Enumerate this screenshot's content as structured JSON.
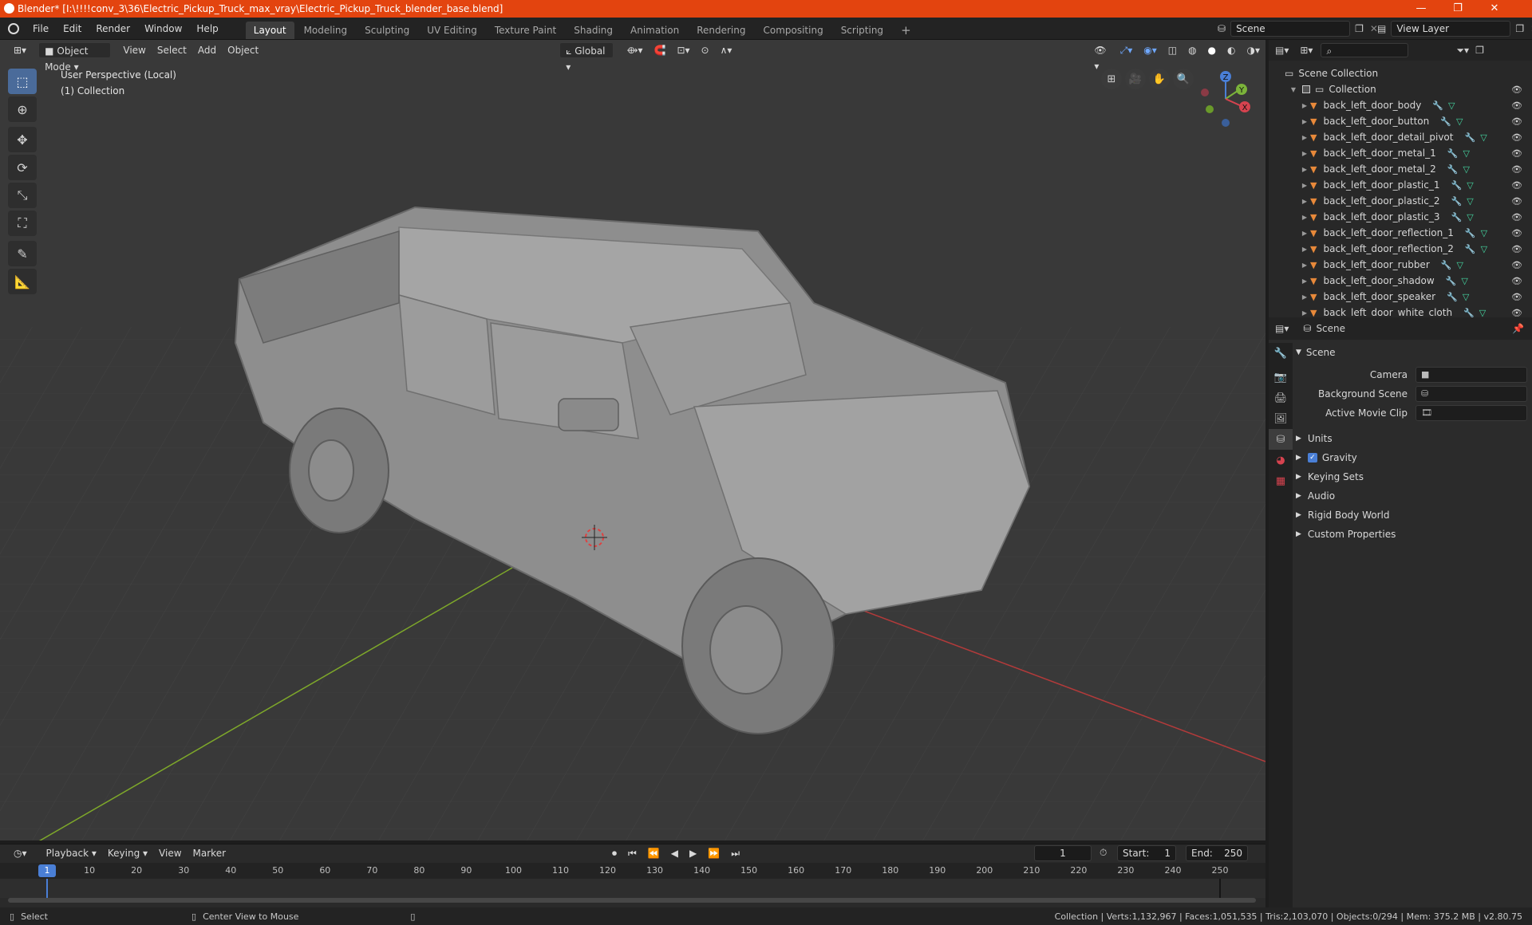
{
  "window": {
    "title": "Blender* [I:\\!!!!conv_3\\36\\Electric_Pickup_Truck_max_vray\\Electric_Pickup_Truck_blender_base.blend]",
    "minimize": "—",
    "maximize": "❐",
    "close": "✕"
  },
  "menu": [
    "File",
    "Edit",
    "Render",
    "Window",
    "Help"
  ],
  "workspaces": [
    "Layout",
    "Modeling",
    "Sculpting",
    "UV Editing",
    "Texture Paint",
    "Shading",
    "Animation",
    "Rendering",
    "Compositing",
    "Scripting"
  ],
  "workspace_add": "+",
  "scene_selector": "Scene",
  "view_layer": "View Layer",
  "viewport_header": {
    "mode": "Object Mode",
    "menus": [
      "View",
      "Select",
      "Add",
      "Object"
    ],
    "orientation": "Global"
  },
  "viewport_overlay": {
    "line1": "User Perspective (Local)",
    "line2": "(1) Collection"
  },
  "gizmo": {
    "x": "X",
    "y": "Y",
    "z": "Z"
  },
  "outliner": {
    "root": "Scene Collection",
    "collection": "Collection",
    "items": [
      "back_left_door_body",
      "back_left_door_button",
      "back_left_door_detail_pivot",
      "back_left_door_metal_1",
      "back_left_door_metal_2",
      "back_left_door_plastic_1",
      "back_left_door_plastic_2",
      "back_left_door_plastic_3",
      "back_left_door_reflection_1",
      "back_left_door_reflection_2",
      "back_left_door_rubber",
      "back_left_door_shadow",
      "back_left_door_speaker",
      "back_left_door_white_cloth"
    ]
  },
  "properties": {
    "context": "Scene",
    "panel_title": "Scene",
    "camera_label": "Camera",
    "background_scene_label": "Background Scene",
    "active_movie_clip_label": "Active Movie Clip",
    "subpanels": [
      "Units",
      "Gravity",
      "Keying Sets",
      "Audio",
      "Rigid Body World",
      "Custom Properties"
    ]
  },
  "timeline": {
    "menus": [
      "Playback",
      "Keying",
      "View",
      "Marker"
    ],
    "current_frame": "1",
    "start_label": "Start:",
    "start": "1",
    "end_label": "End:",
    "end": "250",
    "ticks": [
      "1",
      "10",
      "20",
      "30",
      "40",
      "50",
      "60",
      "70",
      "80",
      "90",
      "100",
      "110",
      "120",
      "130",
      "140",
      "150",
      "160",
      "170",
      "180",
      "190",
      "200",
      "210",
      "220",
      "230",
      "240",
      "250"
    ]
  },
  "status": {
    "left": "Select",
    "middle": "Center View to Mouse",
    "right": "Collection | Verts:1,132,967 | Faces:1,051,535 | Tris:2,103,070 | Objects:0/294 | Mem: 375.2 MB | v2.80.75"
  }
}
